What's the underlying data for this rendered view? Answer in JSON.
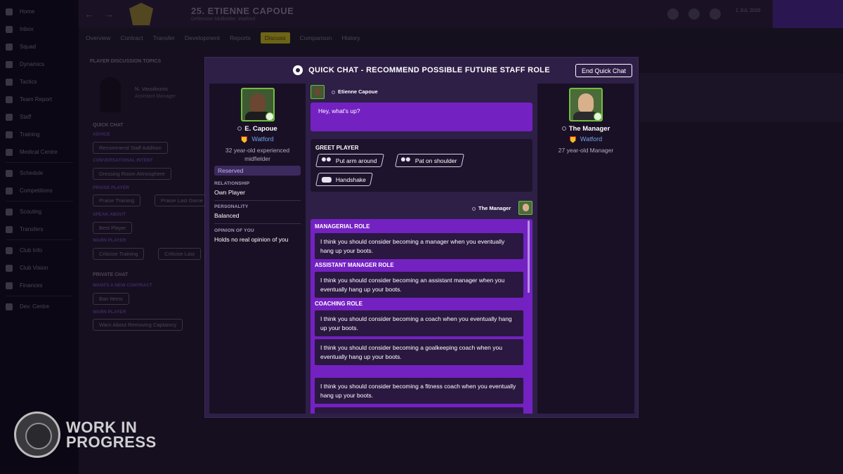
{
  "background": {
    "sidebar_items": [
      "Home",
      "Inbox",
      "Squad",
      "Dynamics",
      "Tactics",
      "Team Report",
      "Staff",
      "Training",
      "Medical Centre",
      "Schedule",
      "Competitions",
      "Scouting",
      "Transfers",
      "Club Info",
      "Club Vision",
      "Finances",
      "Dev. Centre"
    ],
    "player_title": "25. ETIENNE CAPOUE",
    "player_subtitle": "Defensive Midfielder, Watford",
    "date": "1 JUL 2020",
    "subnav": [
      "Overview",
      "Contract",
      "Transfer",
      "Development",
      "Reports",
      "Discuss",
      "Comparison",
      "History"
    ],
    "section_title": "PLAYER DISCUSSION TOPICS",
    "person_name": "N. Vassilounis",
    "person_role": "Assistant Manager",
    "quick_chat_label": "QUICK CHAT",
    "private_chat_label": "PRIVATE CHAT",
    "groups": [
      {
        "label": "ADVICE",
        "pills": [
          "Recommend Staff Addition"
        ]
      },
      {
        "label": "CONVERSATIONAL INTENT",
        "pills": [
          "Dressing Room Atmosphere"
        ]
      },
      {
        "label": "PRAISE PLAYER",
        "pills": [
          "Praise Training",
          "Praise Last Game"
        ]
      },
      {
        "label": "SPEAK ABOUT",
        "pills": [
          "Best Player"
        ]
      },
      {
        "label": "WARN PLAYER",
        "pills": [
          "Criticise Training",
          "Criticise Last"
        ]
      },
      {
        "label": "WANTS A NEW CONTRACT",
        "pills": [
          "Ban Items"
        ]
      },
      {
        "label": "WARN PLAYER",
        "pills": [
          "Warn About Removing Captaincy"
        ]
      }
    ],
    "watermark": {
      "line1": "WORK IN",
      "line2": "PROGRESS"
    }
  },
  "modal": {
    "title": "QUICK CHAT - RECOMMEND POSSIBLE FUTURE STAFF ROLE",
    "end_button": "End Quick Chat",
    "left_person": {
      "name": "E. Capoue",
      "club": "Watford",
      "description": "32 year-old experienced midfielder",
      "status": "Reserved",
      "relationship_label": "RELATIONSHIP",
      "relationship": "Own Player",
      "personality_label": "PERSONALITY",
      "personality": "Balanced",
      "opinion_label": "OPINION OF YOU",
      "opinion": "Holds no real opinion of you"
    },
    "right_person": {
      "name": "The Manager",
      "club": "Watford",
      "description": "27 year-old Manager"
    },
    "chat": {
      "player_speaker": "Etienne Capoue",
      "player_message": "Hey, what's up?",
      "greet_title": "GREET PLAYER",
      "greet_options": [
        "Put arm around",
        "Pat on shoulder",
        "Handshake"
      ],
      "manager_speaker": "The Manager",
      "categories": {
        "managerial": "MANAGERIAL ROLE",
        "assistant": "ASSISTANT MANAGER ROLE",
        "coaching": "COACHING ROLE"
      },
      "options": [
        "I think you should consider becoming a manager when you eventually hang up your boots.",
        "I think you should consider becoming an assistant manager when you eventually hang up your boots.",
        "I think you should consider becoming a coach when you eventually hang up your boots.",
        "I think you should consider becoming a goalkeeping coach when you eventually hang up your boots.",
        "I think you should consider becoming a fitness coach when you eventually hang up your boots."
      ]
    }
  }
}
